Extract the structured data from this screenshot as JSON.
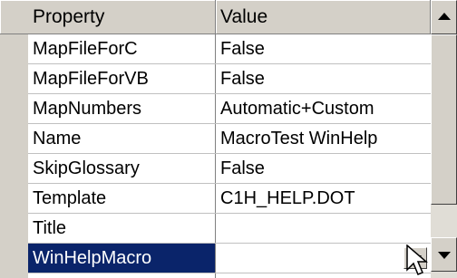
{
  "header": {
    "property_label": "Property",
    "value_label": "Value"
  },
  "rows": [
    {
      "property": "MapFileForC",
      "value": "False"
    },
    {
      "property": "MapFileForVB",
      "value": "False"
    },
    {
      "property": "MapNumbers",
      "value": "Automatic+Custom"
    },
    {
      "property": "Name",
      "value": "MacroTest WinHelp"
    },
    {
      "property": "SkipGlossary",
      "value": "False"
    },
    {
      "property": "Template",
      "value": "C1H_HELP.DOT"
    },
    {
      "property": "Title",
      "value": ""
    },
    {
      "property": "WinHelpMacro",
      "value": ""
    }
  ],
  "selected_row": "WinHelpMacro",
  "icons": {
    "scroll_up": "arrow-up-icon",
    "scroll_down": "arrow-down-icon",
    "dropdown": "chevron-down-icon",
    "cursor": "mouse-pointer-icon"
  },
  "colors": {
    "selection": "#0a246a",
    "chrome": "#d4d0c8"
  }
}
